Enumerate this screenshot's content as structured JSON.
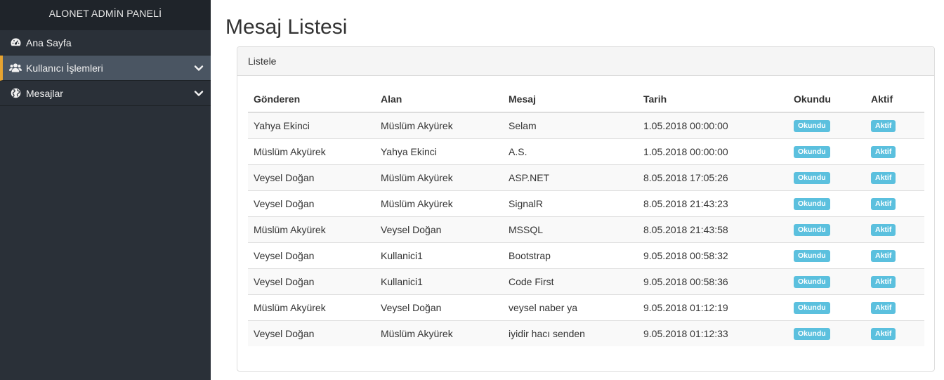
{
  "sidebar": {
    "brand": "ALONET ADMİN PANELİ",
    "items": [
      {
        "label": "Ana Sayfa",
        "icon": "dashboard-icon"
      },
      {
        "label": "Kullanıcı İşlemleri",
        "icon": "users-icon",
        "active": true,
        "has_submenu": true
      },
      {
        "label": "Mesajlar",
        "icon": "globe-icon",
        "has_submenu": true
      }
    ]
  },
  "page": {
    "title": "Mesaj Listesi",
    "panel_heading": "Listele"
  },
  "table": {
    "headers": [
      "Gönderen",
      "Alan",
      "Mesaj",
      "Tarih",
      "Okundu",
      "Aktif"
    ],
    "rows": [
      [
        "Yahya Ekinci",
        "Müslüm Akyürek",
        "Selam",
        "1.05.2018 00:00:00",
        "Okundu",
        "Aktif"
      ],
      [
        "Müslüm Akyürek",
        "Yahya Ekinci",
        "A.S.",
        "1.05.2018 00:00:00",
        "Okundu",
        "Aktif"
      ],
      [
        "Veysel Doğan",
        "Müslüm Akyürek",
        "ASP.NET",
        "8.05.2018 17:05:26",
        "Okundu",
        "Aktif"
      ],
      [
        "Veysel Doğan",
        "Müslüm Akyürek",
        "SignalR",
        "8.05.2018 21:43:23",
        "Okundu",
        "Aktif"
      ],
      [
        "Müslüm Akyürek",
        "Veysel Doğan",
        "MSSQL",
        "8.05.2018 21:43:58",
        "Okundu",
        "Aktif"
      ],
      [
        "Veysel Doğan",
        "Kullanici1",
        "Bootstrap",
        "9.05.2018 00:58:32",
        "Okundu",
        "Aktif"
      ],
      [
        "Veysel Doğan",
        "Kullanici1",
        "Code First",
        "9.05.2018 00:58:36",
        "Okundu",
        "Aktif"
      ],
      [
        "Müslüm Akyürek",
        "Veysel Doğan",
        "veysel naber ya",
        "9.05.2018 01:12:19",
        "Okundu",
        "Aktif"
      ],
      [
        "Veysel Doğan",
        "Müslüm Akyürek",
        "iyidir hacı senden",
        "9.05.2018 01:12:33",
        "Okundu",
        "Aktif"
      ]
    ]
  },
  "colors": {
    "sidebar_bg": "#2a3038",
    "brand_bg": "#1f242a",
    "active_item_bg": "#4a5562",
    "active_accent": "#e7a431",
    "label_info": "#5bc0de"
  }
}
